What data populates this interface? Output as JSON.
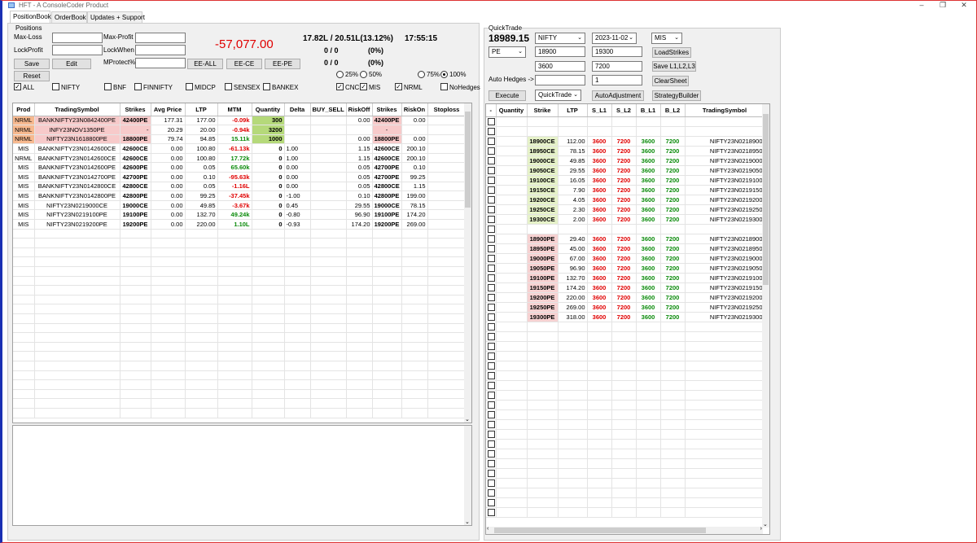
{
  "window": {
    "title": "HFT - A ConsoleCoder Product"
  },
  "tabs": [
    "PositionBook",
    "OrderBook",
    "Updates + Support"
  ],
  "positions": {
    "group_title": "Positions",
    "max_loss_label": "Max-Loss",
    "max_profit_label": "Max-Profit",
    "lock_profit_label": "LockProfit",
    "lock_when_label": "LockWhen",
    "mprotect_label": "MProtect%",
    "save_label": "Save",
    "edit_label": "Edit",
    "reset_label": "Reset",
    "ee_all": "EE-ALL",
    "ee_ce": "EE-CE",
    "ee_pe": "EE-PE",
    "mtm_total": "-57,077.00",
    "margin": "17.82L / 20.51L(13.12%)",
    "time": "17:55:15",
    "count1": "0 / 0",
    "pct1": "(0%)",
    "count2": "0 / 0",
    "pct2": "(0%)",
    "radios": [
      "25%",
      "50%",
      "75%",
      "100%"
    ],
    "filters": [
      {
        "label": "ALL",
        "checked": true
      },
      {
        "label": "NIFTY",
        "checked": false
      },
      {
        "label": "BNF",
        "checked": false
      },
      {
        "label": "FINNIFTY",
        "checked": false
      },
      {
        "label": "MIDCP",
        "checked": false
      },
      {
        "label": "SENSEX",
        "checked": false
      },
      {
        "label": "BANKEX",
        "checked": false
      },
      {
        "label": "CNC",
        "checked": true
      },
      {
        "label": "MIS",
        "checked": true
      },
      {
        "label": "NRML",
        "checked": true
      },
      {
        "label": "NoHedges",
        "checked": false
      }
    ],
    "columns": [
      "Prod",
      "TradingSymbol",
      "Strikes",
      "Avg Price",
      "LTP",
      "MTM",
      "Quantity",
      "Delta",
      "BUY_SELL",
      "RiskOff",
      "Strikes",
      "RiskOn",
      "Stoploss"
    ],
    "rows": [
      [
        "NRML",
        "BANKNIFTY23N0842400PE",
        "42400PE",
        "177.31",
        "177.00",
        "-0.09k",
        "300",
        "",
        "",
        "0.00",
        "42400PE",
        "0.00",
        ""
      ],
      [
        "NRML",
        "INFY23NOV1350PE",
        "-",
        "20.29",
        "20.00",
        "-0.94k",
        "3200",
        "",
        "",
        "",
        "-",
        "",
        ""
      ],
      [
        "NRML",
        "NIFTY23N1618800PE",
        "18800PE",
        "79.74",
        "94.85",
        "15.11k",
        "1000",
        "",
        "",
        "0.00",
        "18800PE",
        "0.00",
        ""
      ],
      [
        "MIS",
        "BANKNIFTY23N0142600CE",
        "42600CE",
        "0.00",
        "100.80",
        "-61.13k",
        "0",
        "1.00",
        "",
        "1.15",
        "42600CE",
        "200.10",
        ""
      ],
      [
        "NRML",
        "BANKNIFTY23N0142600CE",
        "42600CE",
        "0.00",
        "100.80",
        "17.72k",
        "0",
        "1.00",
        "",
        "1.15",
        "42600CE",
        "200.10",
        ""
      ],
      [
        "MIS",
        "BANKNIFTY23N0142600PE",
        "42600PE",
        "0.00",
        "0.05",
        "65.60k",
        "0",
        "0.00",
        "",
        "0.05",
        "42700PE",
        "0.10",
        ""
      ],
      [
        "MIS",
        "BANKNIFTY23N0142700PE",
        "42700PE",
        "0.00",
        "0.10",
        "-95.63k",
        "0",
        "0.00",
        "",
        "0.05",
        "42700PE",
        "99.25",
        ""
      ],
      [
        "MIS",
        "BANKNIFTY23N0142800CE",
        "42800CE",
        "0.00",
        "0.05",
        "-1.16L",
        "0",
        "0.00",
        "",
        "0.05",
        "42800CE",
        "1.15",
        ""
      ],
      [
        "MIS",
        "BANKNIFTY23N0142800PE",
        "42800PE",
        "0.00",
        "99.25",
        "-37.45k",
        "0",
        "-1.00",
        "",
        "0.10",
        "42800PE",
        "199.00",
        ""
      ],
      [
        "MIS",
        "NIFTY23N0219000CE",
        "19000CE",
        "0.00",
        "49.85",
        "-3.67k",
        "0",
        "0.45",
        "",
        "29.55",
        "19000CE",
        "78.15",
        ""
      ],
      [
        "MIS",
        "NIFTY23N0219100PE",
        "19100PE",
        "0.00",
        "132.70",
        "49.24k",
        "0",
        "-0.80",
        "",
        "96.90",
        "19100PE",
        "174.20",
        ""
      ],
      [
        "MIS",
        "NIFTY23N0219200PE",
        "19200PE",
        "0.00",
        "220.00",
        "1.10L",
        "0",
        "-0.93",
        "",
        "174.20",
        "19200PE",
        "269.00",
        ""
      ]
    ]
  },
  "quicktrade": {
    "group_title": "QuickTrade",
    "spot": "18989.15",
    "symbol": "NIFTY",
    "expiry": "2023-11-02",
    "product": "MIS",
    "option_type": "PE",
    "strike_from": "18900",
    "strike_to": "19300",
    "qty1": "3600",
    "qty2": "7200",
    "hedge_qty": "1",
    "hedge_value": "",
    "auto_hedges_label": "Auto Hedges ->",
    "load_strikes": "LoadStrikes",
    "save_levels": "Save L1,L2,L3",
    "clear_sheet": "ClearSheet",
    "execute": "Execute",
    "mode": "QuickTrade",
    "auto_adjustment": "AutoAdjustment",
    "strategy_builder": "StrategyBuilder",
    "columns": [
      "-",
      "Quantity",
      "Strike",
      "LTP",
      "S_L1",
      "S_L2",
      "B_L1",
      "B_L2",
      "TradingSymbol"
    ],
    "rows": [
      {
        "strike": "18900CE",
        "ltp": "112.00",
        "s1": "3600",
        "s2": "7200",
        "b1": "3600",
        "b2": "7200",
        "sym": "NIFTY23N0218900"
      },
      {
        "strike": "18950CE",
        "ltp": "78.15",
        "s1": "3600",
        "s2": "7200",
        "b1": "3600",
        "b2": "7200",
        "sym": "NIFTY23N0218950"
      },
      {
        "strike": "19000CE",
        "ltp": "49.85",
        "s1": "3600",
        "s2": "7200",
        "b1": "3600",
        "b2": "7200",
        "sym": "NIFTY23N0219000"
      },
      {
        "strike": "19050CE",
        "ltp": "29.55",
        "s1": "3600",
        "s2": "7200",
        "b1": "3600",
        "b2": "7200",
        "sym": "NIFTY23N0219050"
      },
      {
        "strike": "19100CE",
        "ltp": "16.05",
        "s1": "3600",
        "s2": "7200",
        "b1": "3600",
        "b2": "7200",
        "sym": "NIFTY23N0219100"
      },
      {
        "strike": "19150CE",
        "ltp": "7.90",
        "s1": "3600",
        "s2": "7200",
        "b1": "3600",
        "b2": "7200",
        "sym": "NIFTY23N0219150"
      },
      {
        "strike": "19200CE",
        "ltp": "4.05",
        "s1": "3600",
        "s2": "7200",
        "b1": "3600",
        "b2": "7200",
        "sym": "NIFTY23N0219200"
      },
      {
        "strike": "19250CE",
        "ltp": "2.30",
        "s1": "3600",
        "s2": "7200",
        "b1": "3600",
        "b2": "7200",
        "sym": "NIFTY23N0219250"
      },
      {
        "strike": "19300CE",
        "ltp": "2.00",
        "s1": "3600",
        "s2": "7200",
        "b1": "3600",
        "b2": "7200",
        "sym": "NIFTY23N0219300"
      },
      {
        "strike": "18900PE",
        "ltp": "29.40",
        "s1": "3600",
        "s2": "7200",
        "b1": "3600",
        "b2": "7200",
        "sym": "NIFTY23N0218900"
      },
      {
        "strike": "18950PE",
        "ltp": "45.00",
        "s1": "3600",
        "s2": "7200",
        "b1": "3600",
        "b2": "7200",
        "sym": "NIFTY23N0218950"
      },
      {
        "strike": "19000PE",
        "ltp": "67.00",
        "s1": "3600",
        "s2": "7200",
        "b1": "3600",
        "b2": "7200",
        "sym": "NIFTY23N0219000"
      },
      {
        "strike": "19050PE",
        "ltp": "96.90",
        "s1": "3600",
        "s2": "7200",
        "b1": "3600",
        "b2": "7200",
        "sym": "NIFTY23N0219050"
      },
      {
        "strike": "19100PE",
        "ltp": "132.70",
        "s1": "3600",
        "s2": "7200",
        "b1": "3600",
        "b2": "7200",
        "sym": "NIFTY23N0219100"
      },
      {
        "strike": "19150PE",
        "ltp": "174.20",
        "s1": "3600",
        "s2": "7200",
        "b1": "3600",
        "b2": "7200",
        "sym": "NIFTY23N0219150"
      },
      {
        "strike": "19200PE",
        "ltp": "220.00",
        "s1": "3600",
        "s2": "7200",
        "b1": "3600",
        "b2": "7200",
        "sym": "NIFTY23N0219200"
      },
      {
        "strike": "19250PE",
        "ltp": "269.00",
        "s1": "3600",
        "s2": "7200",
        "b1": "3600",
        "b2": "7200",
        "sym": "NIFTY23N0219250"
      },
      {
        "strike": "19300PE",
        "ltp": "318.00",
        "s1": "3600",
        "s2": "7200",
        "b1": "3600",
        "b2": "7200",
        "sym": "NIFTY23N0219300"
      }
    ]
  },
  "colors": {
    "accent_red": "#e00000",
    "accent_green": "#0a8a0a",
    "frame_blue": "#1a2fb3"
  }
}
